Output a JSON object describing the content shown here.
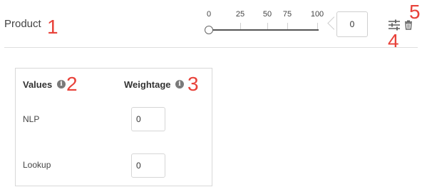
{
  "header": {
    "title": "Product"
  },
  "slider": {
    "ticks": [
      "0",
      "25",
      "50",
      "75",
      "100"
    ],
    "value": 0,
    "display_value": "0"
  },
  "table": {
    "col_values": "Values",
    "col_weightage": "Weightage",
    "rows": [
      {
        "label": "NLP",
        "value": "0"
      },
      {
        "label": "Lookup",
        "value": "0"
      }
    ]
  },
  "annotations": [
    "1",
    "2",
    "3",
    "4",
    "5"
  ],
  "icons": {
    "info": "info-icon",
    "settings": "sliders-icon",
    "delete": "trash-icon"
  },
  "colors": {
    "annotation": "#e8423a",
    "icon": "#7a7a7a"
  }
}
